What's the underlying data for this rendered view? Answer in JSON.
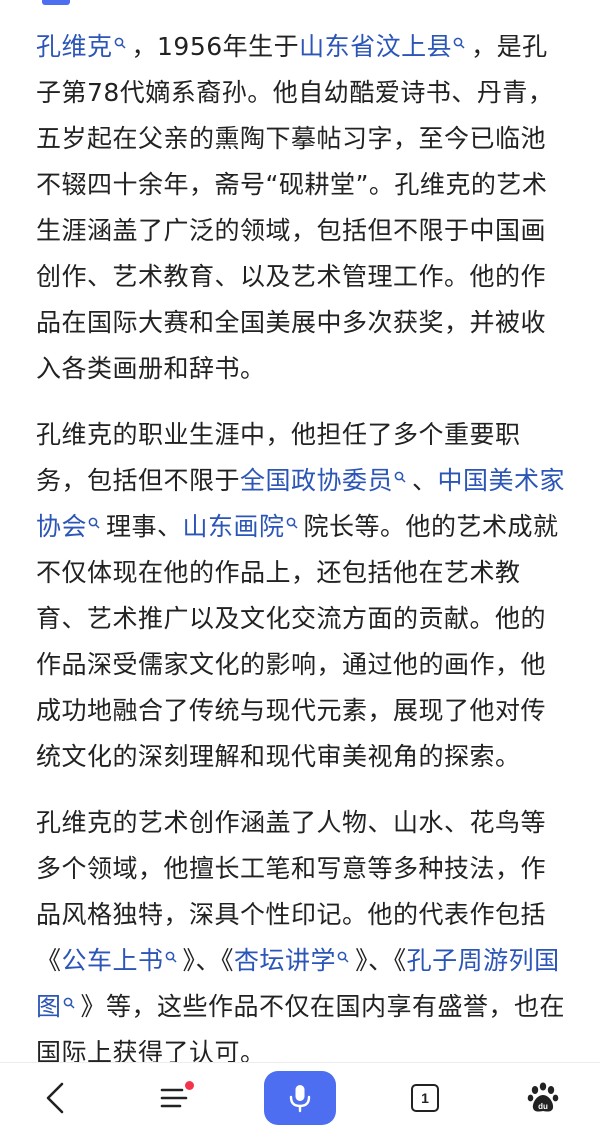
{
  "article": {
    "p1": {
      "s1_link": "孔维克",
      "s2": "，1956年生于",
      "s3_link": "山东省汶上县",
      "s4": "，是孔子第78代嫡系裔孙。他自幼酷爱诗书、丹青，五岁起在父亲的熏陶下摹帖习字，至今已临池不辍四十余年，斋号“砚耕堂”。孔维克的艺术生涯涵盖了广泛的领域，包括但不限于中国画创作、艺术教育、以及艺术管理工作。他的作品在国际大赛和全国美展中多次获奖，并被收入各类画册和辞书。"
    },
    "p2": {
      "s1": "孔维克的职业生涯中，他担任了多个重要职务，包括但不限于",
      "s2_link": "全国政协委员",
      "s3": "、",
      "s4_link": "中国美术家协会",
      "s5": "理事、",
      "s6_link": "山东画院",
      "s7": "院长等。他的艺术成就不仅体现在他的作品上，还包括他在艺术教育、艺术推广以及文化交流方面的贡献。他的作品深受儒家文化的影响，通过他的画作，他成功地融合了传统与现代元素，展现了他对传统文化的深刻理解和现代审美视角的探索。"
    },
    "p3": {
      "s1": "孔维克的艺术创作涵盖了人物、山水、花鸟等多个领域，他擅长工笔和写意等多种技法，作品风格独特，深具个性印记。他的代表作包括《",
      "s2_link": "公车上书",
      "s3": "》、《",
      "s4_link": "杏坛讲学",
      "s5": "》、《",
      "s6_link": "孔子周游列国图",
      "s7": "》等，这些作品不仅在国内享有盛誉，也在国际上获得了认可。"
    }
  },
  "bottom_bar": {
    "tab_count": "1",
    "icons": [
      "back-arrow-icon",
      "menu-icon",
      "microphone-icon",
      "tabs-icon",
      "baidu-paw-icon"
    ],
    "accent_color": "#4e6ef2",
    "notification_dot_color": "#f2334a"
  },
  "colors": {
    "link": "#2b55b6",
    "text": "#222222"
  }
}
